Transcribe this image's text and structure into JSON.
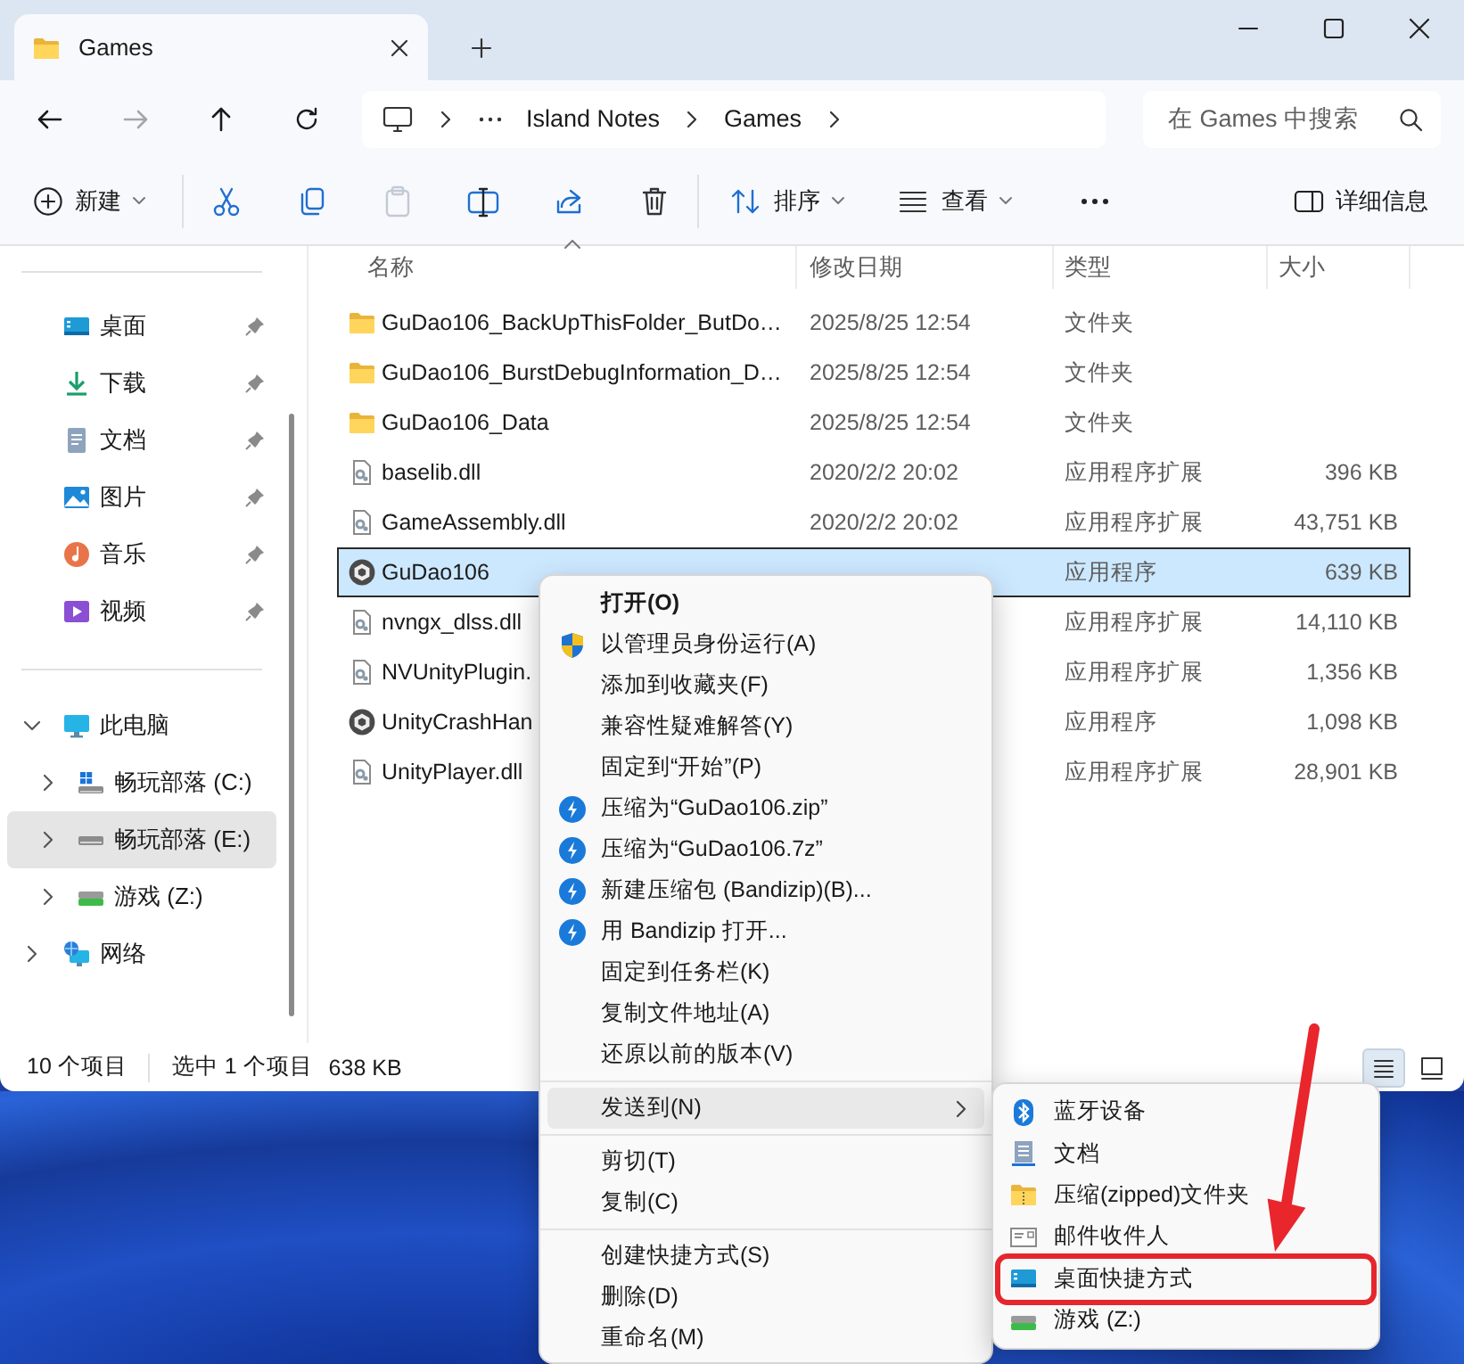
{
  "window": {
    "tab_title": "Games"
  },
  "navigation": {
    "forward_disabled": true,
    "breadcrumbs": [
      "Island Notes",
      "Games"
    ],
    "search_placeholder": "在 Games 中搜索"
  },
  "toolbar": {
    "new_label": "新建",
    "paste_disabled": true,
    "sort_label": "排序",
    "view_label": "查看",
    "details_label": "详细信息"
  },
  "sidebar": {
    "quick_access": [
      {
        "label": "桌面",
        "kind": "desktop",
        "pinned": true,
        "selected": false
      },
      {
        "label": "下载",
        "kind": "downloads",
        "pinned": true,
        "selected": false
      },
      {
        "label": "文档",
        "kind": "documents",
        "pinned": true,
        "selected": false
      },
      {
        "label": "图片",
        "kind": "pictures",
        "pinned": true,
        "selected": false
      },
      {
        "label": "音乐",
        "kind": "music",
        "pinned": true,
        "selected": false
      },
      {
        "label": "视频",
        "kind": "videos",
        "pinned": true,
        "selected": false
      }
    ],
    "tree": [
      {
        "label": "此电脑",
        "kind": "pc",
        "expanded": true,
        "selected": false,
        "children": [
          {
            "label": "畅玩部落 (C:)",
            "kind": "system-drive",
            "expanded": false,
            "selected": false
          },
          {
            "label": "畅玩部落 (E:)",
            "kind": "drive",
            "expanded": false,
            "selected": true
          },
          {
            "label": "游戏 (Z:)",
            "kind": "usb-drive",
            "expanded": false,
            "selected": false
          }
        ]
      },
      {
        "label": "网络",
        "kind": "network",
        "expanded": false,
        "selected": false
      }
    ]
  },
  "file_list": {
    "columns": [
      "名称",
      "修改日期",
      "类型",
      "大小"
    ],
    "rows": [
      {
        "kind": "folder",
        "name": "GuDao106_BackUpThisFolder_ButDo…",
        "date": "2025/8/25 12:54",
        "type": "文件夹",
        "selected": false
      },
      {
        "kind": "folder",
        "name": "GuDao106_BurstDebugInformation_D…",
        "date": "2025/8/25 12:54",
        "type": "文件夹",
        "selected": false
      },
      {
        "kind": "folder",
        "name": "GuDao106_Data",
        "date": "2025/8/25 12:54",
        "type": "文件夹",
        "selected": false
      },
      {
        "kind": "dll",
        "name": "baselib.dll",
        "date": "2020/2/2 20:02",
        "type": "应用程序扩展",
        "size": "396 KB",
        "selected": false
      },
      {
        "kind": "dll",
        "name": "GameAssembly.dll",
        "date": "2020/2/2 20:02",
        "type": "应用程序扩展",
        "size": "43,751 KB",
        "selected": false
      },
      {
        "kind": "app",
        "name": "GuDao106",
        "type": "应用程序",
        "size": "639 KB",
        "selected": true
      },
      {
        "kind": "dll",
        "name": "nvngx_dlss.dll",
        "type": "应用程序扩展",
        "size": "14,110 KB",
        "selected": false
      },
      {
        "kind": "dll",
        "name": "NVUnityPlugin.",
        "type": "应用程序扩展",
        "size": "1,356 KB",
        "selected": false
      },
      {
        "kind": "app",
        "name": "UnityCrashHan",
        "type": "应用程序",
        "size": "1,098 KB",
        "selected": false
      },
      {
        "kind": "dll",
        "name": "UnityPlayer.dll",
        "type": "应用程序扩展",
        "size": "28,901 KB",
        "selected": false
      }
    ]
  },
  "status_bar": {
    "item_count": "10 个项目",
    "selection": "选中 1 个项目",
    "selection_size": "638 KB",
    "view_buttons": [
      {
        "selected": true
      },
      {
        "selected": false
      }
    ]
  },
  "context_menu": {
    "groups": [
      [
        {
          "label": "打开(O)",
          "kind": "plain",
          "default": true,
          "has_submenu": false,
          "highlighted": false
        },
        {
          "label": "以管理员身份运行(A)",
          "kind": "shield",
          "default": false,
          "has_submenu": false,
          "highlighted": false
        },
        {
          "label": "添加到收藏夹(F)",
          "kind": "plain",
          "default": false,
          "has_submenu": false,
          "highlighted": false
        },
        {
          "label": "兼容性疑难解答(Y)",
          "kind": "plain",
          "default": false,
          "has_submenu": false,
          "highlighted": false
        },
        {
          "label": "固定到“开始”(P)",
          "kind": "plain",
          "default": false,
          "has_submenu": false,
          "highlighted": false
        },
        {
          "label": "压缩为“GuDao106.zip”",
          "kind": "bandizip",
          "default": false,
          "has_submenu": false,
          "highlighted": false
        },
        {
          "label": "压缩为“GuDao106.7z”",
          "kind": "bandizip",
          "default": false,
          "has_submenu": false,
          "highlighted": false
        },
        {
          "label": "新建压缩包 (Bandizip)(B)...",
          "kind": "bandizip",
          "default": false,
          "has_submenu": false,
          "highlighted": false
        },
        {
          "label": "用 Bandizip 打开...",
          "kind": "bandizip",
          "default": false,
          "has_submenu": false,
          "highlighted": false
        },
        {
          "label": "固定到任务栏(K)",
          "kind": "plain",
          "default": false,
          "has_submenu": false,
          "highlighted": false
        },
        {
          "label": "复制文件地址(A)",
          "kind": "plain",
          "default": false,
          "has_submenu": false,
          "highlighted": false
        },
        {
          "label": "还原以前的版本(V)",
          "kind": "plain",
          "default": false,
          "has_submenu": false,
          "highlighted": false
        }
      ],
      [
        {
          "label": "发送到(N)",
          "kind": "plain",
          "default": false,
          "has_submenu": true,
          "highlighted": true
        }
      ],
      [
        {
          "label": "剪切(T)",
          "kind": "plain",
          "default": false,
          "has_submenu": false,
          "highlighted": false
        },
        {
          "label": "复制(C)",
          "kind": "plain",
          "default": false,
          "has_submenu": false,
          "highlighted": false
        }
      ],
      [
        {
          "label": "创建快捷方式(S)",
          "kind": "plain",
          "default": false,
          "has_submenu": false,
          "highlighted": false
        },
        {
          "label": "删除(D)",
          "kind": "plain",
          "default": false,
          "has_submenu": false,
          "highlighted": false
        },
        {
          "label": "重命名(M)",
          "kind": "plain",
          "default": false,
          "has_submenu": false,
          "highlighted": false
        }
      ]
    ]
  },
  "send_to_menu": {
    "items": [
      {
        "label": "蓝牙设备",
        "kind": "bluetooth",
        "annotated": false
      },
      {
        "label": "文档",
        "kind": "documents",
        "annotated": false
      },
      {
        "label": "压缩(zipped)文件夹",
        "kind": "zip-folder",
        "annotated": false
      },
      {
        "label": "邮件收件人",
        "kind": "mail",
        "annotated": false
      },
      {
        "label": "桌面快捷方式",
        "kind": "desktop",
        "annotated": true
      },
      {
        "label": "游戏 (Z:)",
        "kind": "drive",
        "annotated": false
      }
    ]
  }
}
